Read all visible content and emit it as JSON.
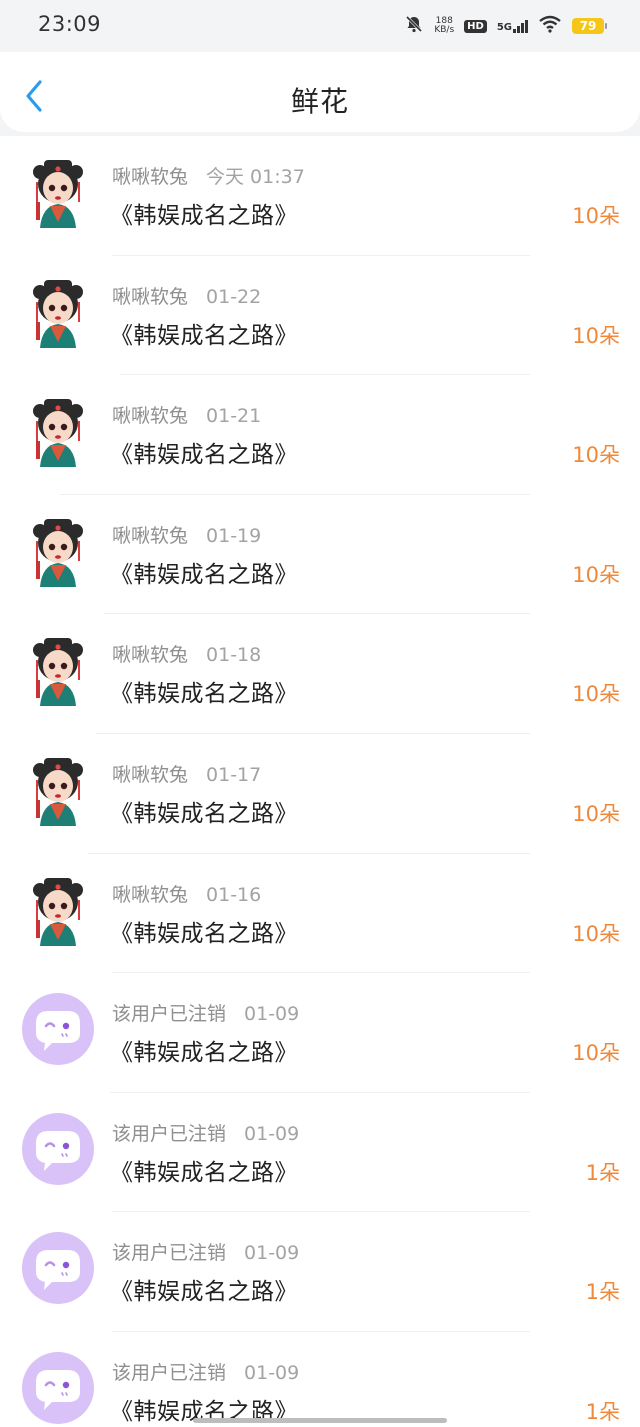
{
  "status_bar": {
    "time": "23:09",
    "net_speed_value": "188",
    "net_speed_unit": "KB/s",
    "hd_label": "HD",
    "network_label": "5G",
    "battery_level": "79",
    "icons": [
      "mute-bell-icon",
      "wifi-icon",
      "signal-icon",
      "battery-icon"
    ]
  },
  "header": {
    "back_icon": "chevron-left-icon",
    "title": "鲜花"
  },
  "colors": {
    "accent_blue": "#2b9bf0",
    "amount_orange": "#f0883a",
    "avatar_purple": "#d8c2f7"
  },
  "records": [
    {
      "user": "啾啾软兔",
      "date": "今天 01:37",
      "book": "《韩娱成名之路》",
      "amount": "10朵",
      "avatar": "girl-avatar"
    },
    {
      "user": "啾啾软兔",
      "date": "01-22",
      "book": "《韩娱成名之路》",
      "amount": "10朵",
      "avatar": "girl-avatar"
    },
    {
      "user": "啾啾软兔",
      "date": "01-21",
      "book": "《韩娱成名之路》",
      "amount": "10朵",
      "avatar": "girl-avatar"
    },
    {
      "user": "啾啾软兔",
      "date": "01-19",
      "book": "《韩娱成名之路》",
      "amount": "10朵",
      "avatar": "girl-avatar"
    },
    {
      "user": "啾啾软兔",
      "date": "01-18",
      "book": "《韩娱成名之路》",
      "amount": "10朵",
      "avatar": "girl-avatar"
    },
    {
      "user": "啾啾软兔",
      "date": "01-17",
      "book": "《韩娱成名之路》",
      "amount": "10朵",
      "avatar": "girl-avatar"
    },
    {
      "user": "啾啾软兔",
      "date": "01-16",
      "book": "《韩娱成名之路》",
      "amount": "10朵",
      "avatar": "girl-avatar"
    },
    {
      "user": "该用户已注销",
      "date": "01-09",
      "book": "《韩娱成名之路》",
      "amount": "10朵",
      "avatar": "default-chat-avatar"
    },
    {
      "user": "该用户已注销",
      "date": "01-09",
      "book": "《韩娱成名之路》",
      "amount": "1朵",
      "avatar": "default-chat-avatar"
    },
    {
      "user": "该用户已注销",
      "date": "01-09",
      "book": "《韩娱成名之路》",
      "amount": "1朵",
      "avatar": "default-chat-avatar"
    },
    {
      "user": "该用户已注销",
      "date": "01-09",
      "book": "《韩娱成名之路》",
      "amount": "1朵",
      "avatar": "default-chat-avatar"
    }
  ]
}
